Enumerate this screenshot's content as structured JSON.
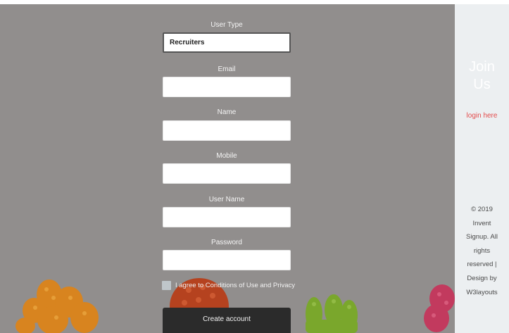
{
  "form": {
    "user_type_label": "User Type",
    "user_type_value": "Recruiters",
    "email_label": "Email",
    "name_label": "Name",
    "mobile_label": "Mobile",
    "username_label": "User Name",
    "password_label": "Password",
    "agree_text": "I agree to Conditions of Use and Privacy",
    "create_button": "Create account"
  },
  "side": {
    "join_line1": "Join",
    "join_line2": "Us",
    "login_link": "login here",
    "copyright_lines": [
      "© 2019",
      "Invent",
      "Signup. All",
      "rights",
      "reserved |",
      "Design by",
      "W3layouts"
    ]
  },
  "colors": {
    "main_bg": "#918e8d",
    "side_bg": "#eceff1",
    "button_bg": "#2b2b2b",
    "login_link": "#e34b4b"
  }
}
